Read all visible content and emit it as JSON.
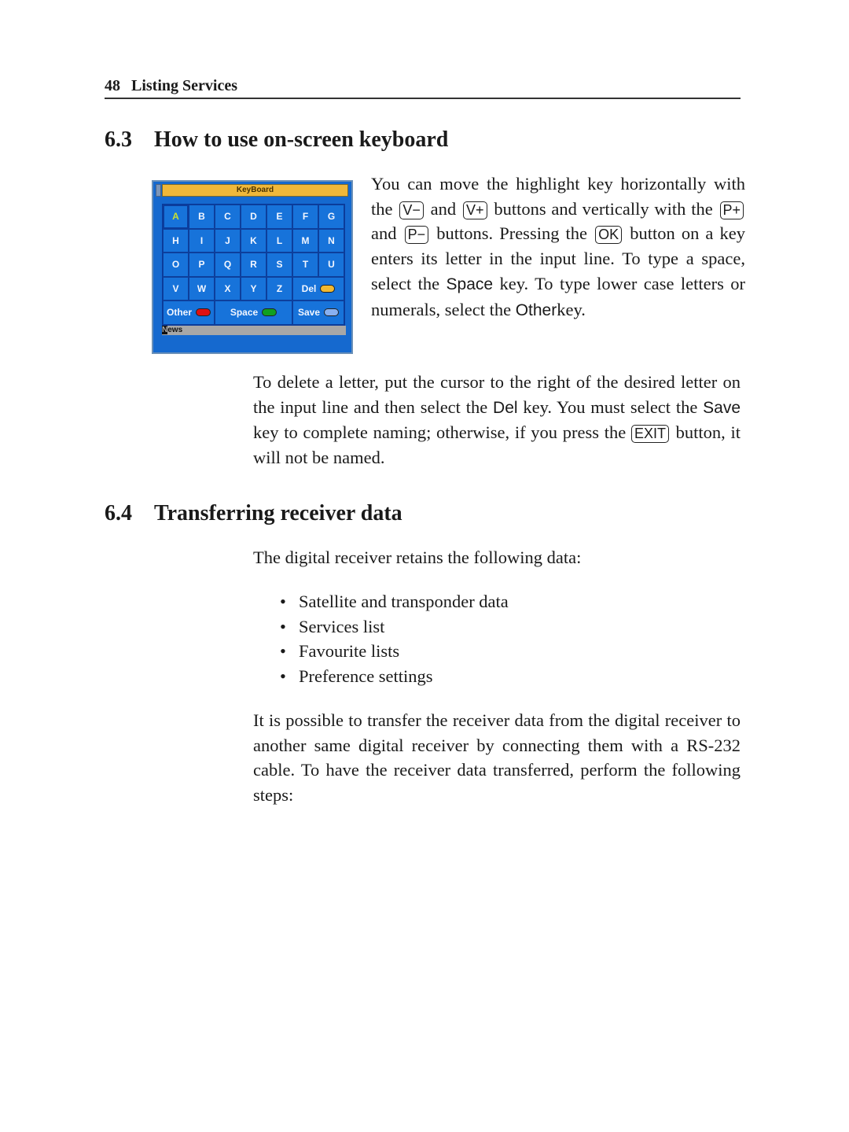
{
  "header": {
    "page_number": "48",
    "chapter": "Listing Services"
  },
  "section_63": {
    "number": "6.3",
    "title": "How to use on-screen keyboard",
    "para1": {
      "t1": "You can move the highlight key horizontally with the",
      "k1": "V−",
      "t2": "and",
      "k2": "V+",
      "t3": "buttons and vertically with the",
      "k3": "P+",
      "t4": "and",
      "k4": "P−",
      "t5": "buttons. Pressing the",
      "k5": "OK",
      "t6": "button on a key enters its letter in the input line. To type a space, select the",
      "s1": "Space",
      "t7": "key. To type lower case letters or numerals, select the",
      "s2": "Other",
      "t8": "key."
    },
    "para2": {
      "t1": "To delete a letter, put the cursor to the right of the desired letter on the input line and then select the",
      "s1": "Del",
      "t2": "key. You must select the",
      "s2": "Save",
      "t3": "key to complete naming; otherwise, if you press the",
      "k1": "EXIT",
      "t4": "button, it will not be named."
    }
  },
  "keyboard": {
    "title": "KeyBoard",
    "rows": [
      [
        "A",
        "B",
        "C",
        "D",
        "E",
        "F",
        "G"
      ],
      [
        "H",
        "I",
        "J",
        "K",
        "L",
        "M",
        "N"
      ],
      [
        "O",
        "P",
        "Q",
        "R",
        "S",
        "T",
        "U"
      ],
      [
        "V",
        "W",
        "X",
        "Y",
        "Z"
      ]
    ],
    "selected_key": "A",
    "del_label": "Del",
    "other_label": "Other",
    "space_label": "Space",
    "save_label": "Save",
    "colors": {
      "del": "#f0b830",
      "other": "#e01010",
      "space": "#10a020",
      "save": "#88b0f0",
      "highlight_text": "#c8e030"
    },
    "input_cursor_char": "N",
    "input_rest": "ews"
  },
  "section_64": {
    "number": "6.4",
    "title": "Transferring receiver data",
    "intro": "The digital receiver retains the following data:",
    "items": [
      "Satellite and transponder data",
      "Services list",
      "Favourite lists",
      "Preference settings"
    ],
    "para": "It is possible to transfer the receiver data from the digital re­ceiver to another same digital receiver by connecting them with a RS-232 cable. To have the receiver data transferred, perform the following steps:"
  }
}
